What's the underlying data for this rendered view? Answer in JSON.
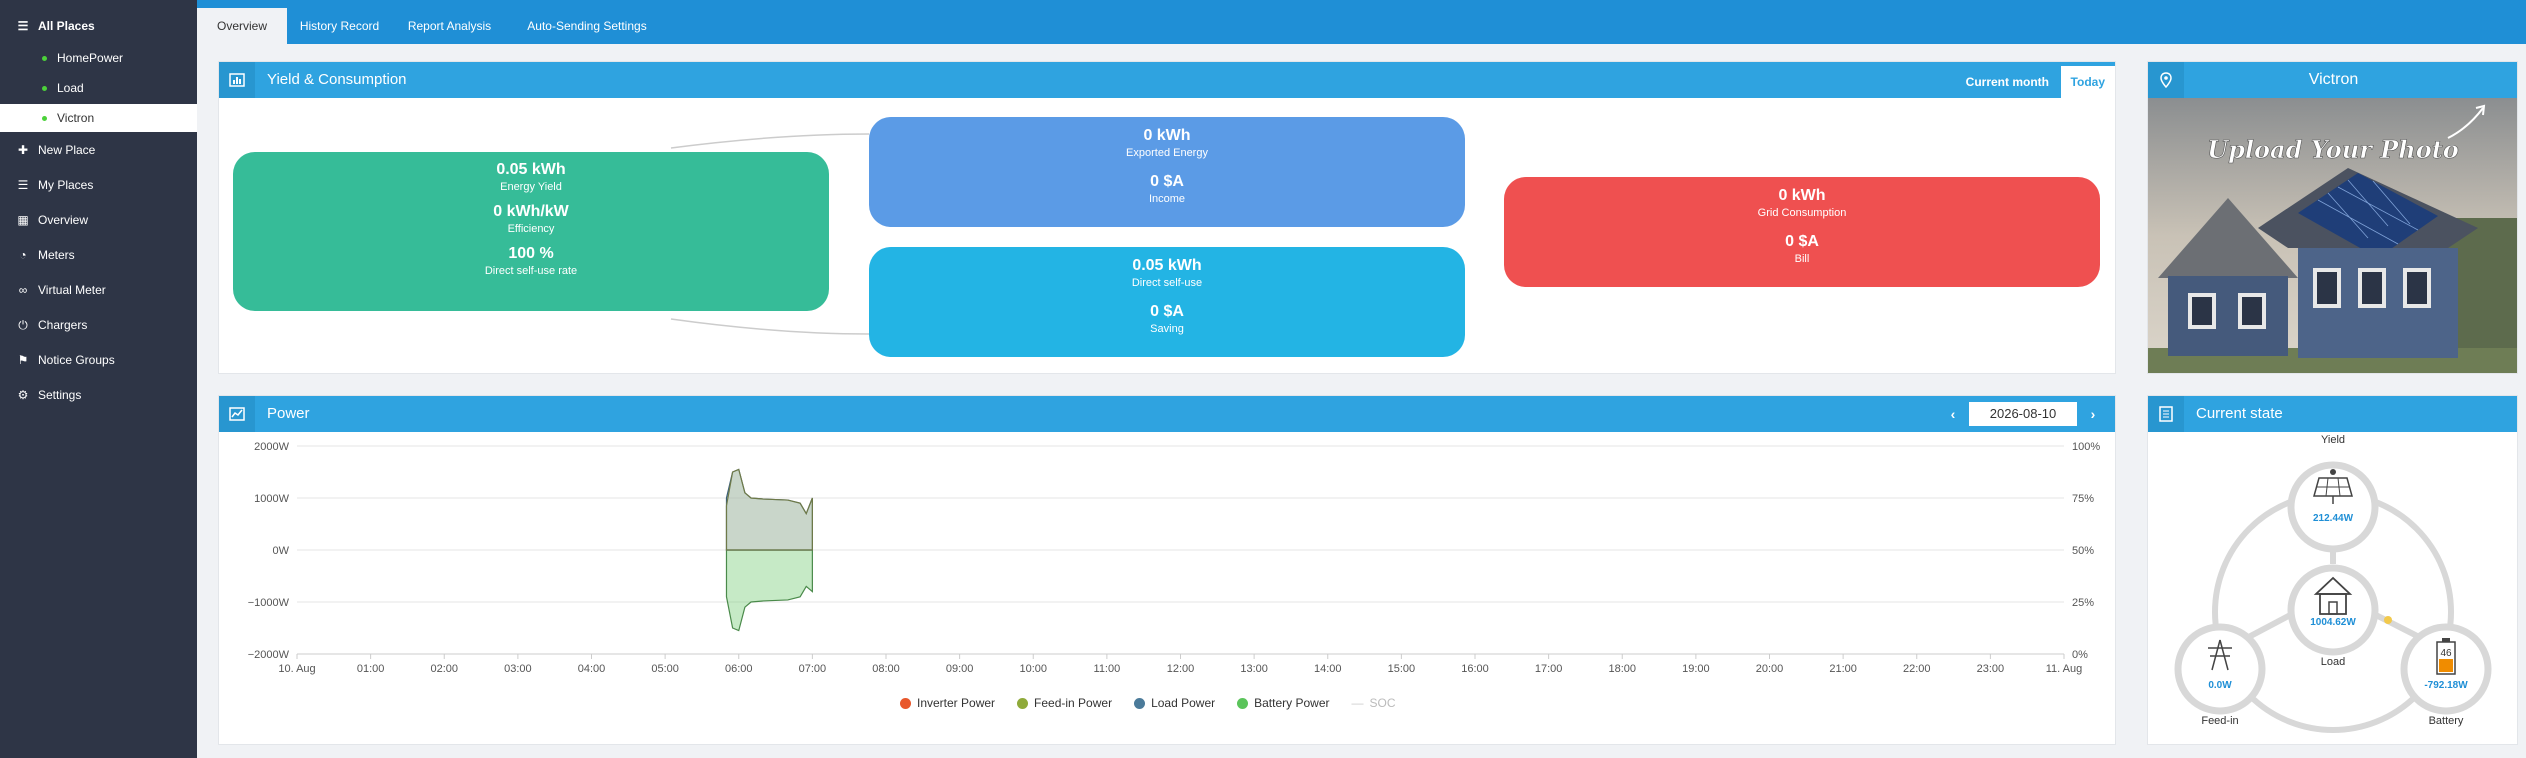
{
  "sidebar": {
    "all_places": "All Places",
    "places": [
      "HomePower",
      "Load",
      "Victron"
    ],
    "items": [
      {
        "label": "New Place",
        "icon": "plus-icon"
      },
      {
        "label": "My Places",
        "icon": "list-icon"
      },
      {
        "label": "Overview",
        "icon": "grid-icon"
      },
      {
        "label": "Meters",
        "icon": "gauge-icon"
      },
      {
        "label": "Virtual Meter",
        "icon": "link-icon"
      },
      {
        "label": "Chargers",
        "icon": "power-icon"
      },
      {
        "label": "Notice Groups",
        "icon": "bell-icon"
      },
      {
        "label": "Settings",
        "icon": "gear-icon"
      }
    ]
  },
  "tabs": [
    "Overview",
    "History Record",
    "Report Analysis",
    "Auto-Sending Settings"
  ],
  "yield_panel": {
    "title": "Yield & Consumption",
    "range_options": [
      "Current month",
      "Today"
    ],
    "yield_box": {
      "energy": "0.05 kWh",
      "energy_label": "Energy Yield",
      "efficiency": "0 kWh/kW",
      "efficiency_label": "Efficiency",
      "rate": "100 %",
      "rate_label": "Direct self-use rate"
    },
    "exported_box": {
      "energy": "0 kWh",
      "energy_label": "Exported Energy",
      "income": "0 $A",
      "income_label": "Income"
    },
    "selfuse_box": {
      "energy": "0.05 kWh",
      "energy_label": "Direct self-use",
      "saving": "0 $A",
      "saving_label": "Saving"
    },
    "grid_box": {
      "energy": "0 kWh",
      "energy_label": "Grid Consumption",
      "bill": "0 $A",
      "bill_label": "Bill"
    }
  },
  "photo_panel": {
    "title": "Victron",
    "upload_text": "Upload Your Photo"
  },
  "power_panel": {
    "title": "Power",
    "date": "2026-08-10"
  },
  "current_state": {
    "title": "Current state",
    "yield_label": "Yield",
    "yield_value": "212.44W",
    "load_label": "Load",
    "load_value": "1004.62W",
    "feedin_label": "Feed-in",
    "feedin_value": "0.0W",
    "battery_label": "Battery",
    "battery_value": "-792.18W",
    "battery_soc": "46",
    "colors": {
      "value": "#1f8fd6",
      "ring": "#d8d8d8"
    }
  },
  "chart_data": {
    "type": "area",
    "y_left_ticks": [
      "2000W",
      "1000W",
      "0W",
      "−1000W",
      "−2000W"
    ],
    "y_right_ticks": [
      "100%",
      "75%",
      "50%",
      "25%",
      "0%"
    ],
    "x_ticks": [
      "10. Aug",
      "01:00",
      "02:00",
      "03:00",
      "04:00",
      "05:00",
      "06:00",
      "07:00",
      "08:00",
      "09:00",
      "10:00",
      "11:00",
      "12:00",
      "13:00",
      "14:00",
      "15:00",
      "16:00",
      "17:00",
      "18:00",
      "19:00",
      "20:00",
      "21:00",
      "22:00",
      "23:00",
      "11. Aug"
    ],
    "ylim": [
      -2000,
      2000
    ],
    "y2lim": [
      0,
      100
    ],
    "grid": true,
    "legend_position": "bottom-center",
    "series": [
      {
        "name": "Inverter Power",
        "color": "#e8572b",
        "x": [
          "05:50",
          "05:55",
          "06:00",
          "06:05",
          "06:10",
          "06:20",
          "06:30",
          "06:40",
          "06:50",
          "06:55",
          "07:00"
        ],
        "values": [
          850,
          1500,
          1550,
          1100,
          1000,
          980,
          970,
          960,
          900,
          700,
          1000
        ]
      },
      {
        "name": "Feed-in Power",
        "color": "#8faa3a",
        "x": [
          "05:50",
          "07:00"
        ],
        "values": [
          0,
          0
        ]
      },
      {
        "name": "Load Power",
        "color": "#4b7b9a",
        "x": [
          "05:50",
          "05:55",
          "06:00",
          "06:05",
          "06:10",
          "06:20",
          "06:30",
          "06:40",
          "06:50",
          "06:55",
          "07:00"
        ],
        "values": [
          1000,
          1500,
          1550,
          1100,
          1000,
          980,
          970,
          960,
          900,
          700,
          1000
        ]
      },
      {
        "name": "Battery Power",
        "color": "#5bc45b",
        "x": [
          "05:50",
          "05:55",
          "06:00",
          "06:05",
          "06:10",
          "06:20",
          "06:30",
          "06:40",
          "06:50",
          "06:55",
          "07:00"
        ],
        "values": [
          -900,
          -1500,
          -1550,
          -1100,
          -1000,
          -980,
          -970,
          -960,
          -900,
          -700,
          -800
        ]
      },
      {
        "name": "SOC",
        "color": "#c8c8c8",
        "x": [],
        "values": []
      }
    ]
  }
}
